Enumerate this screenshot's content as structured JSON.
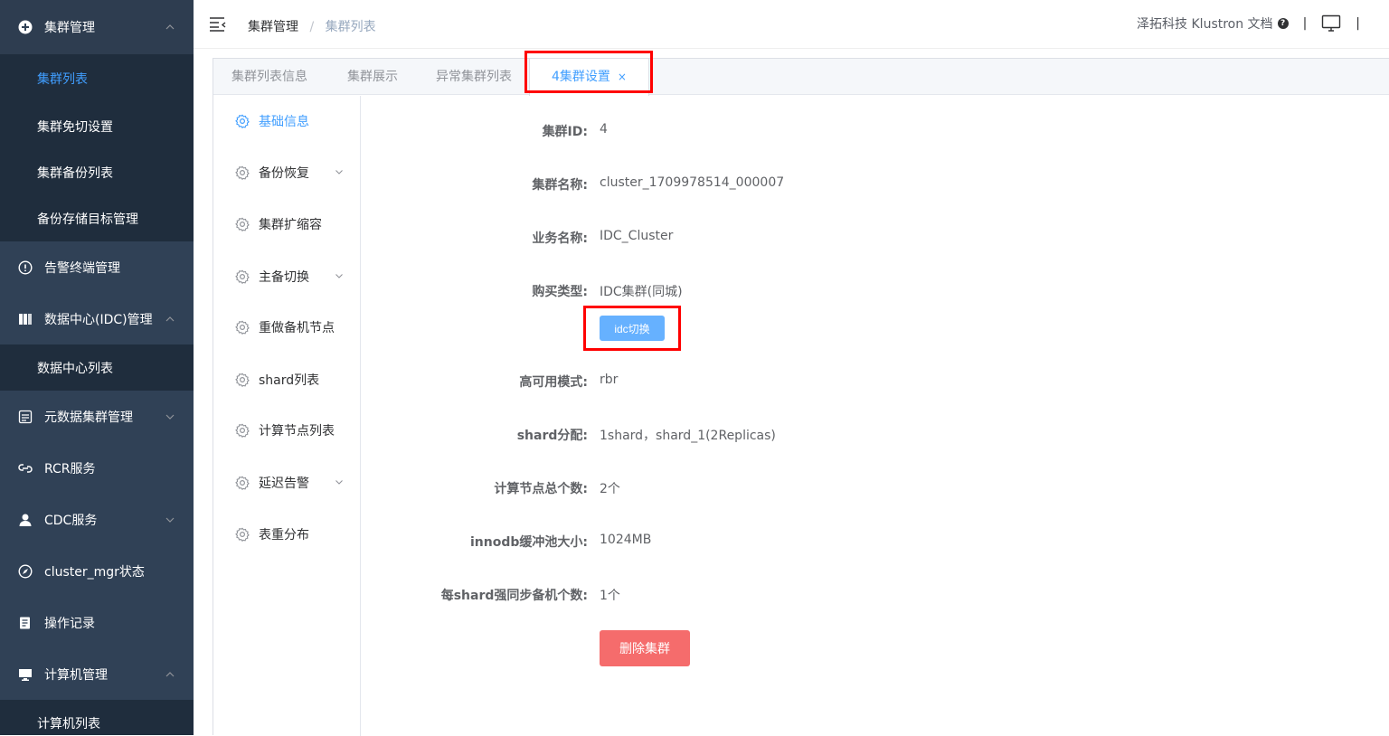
{
  "sidebar": {
    "groups": [
      {
        "label": "集群管理",
        "icon": "plus-circle-icon",
        "expanded": true,
        "items": [
          "集群列表",
          "集群免切设置",
          "集群备份列表",
          "备份存储目标管理"
        ],
        "active_item": "集群列表"
      },
      {
        "label": "告警终端管理",
        "icon": "info-circle-icon"
      },
      {
        "label": "数据中心(IDC)管理",
        "icon": "chart-bar-icon",
        "expanded": true,
        "items": [
          "数据中心列表"
        ]
      },
      {
        "label": "元数据集群管理",
        "icon": "database-icon"
      },
      {
        "label": "RCR服务",
        "icon": "link-icon"
      },
      {
        "label": "CDC服务",
        "icon": "user-icon"
      },
      {
        "label": "cluster_mgr状态",
        "icon": "compass-icon"
      },
      {
        "label": "操作记录",
        "icon": "log-icon"
      },
      {
        "label": "计算机管理",
        "icon": "computer-icon",
        "expanded": true,
        "items": [
          "计算机列表"
        ]
      }
    ]
  },
  "header": {
    "breadcrumb": [
      "集群管理",
      "集群列表"
    ],
    "separator": "/",
    "right_link": "泽拓科技 Klustron 文档",
    "help_icon": "?",
    "pipe": "|"
  },
  "tabs": [
    {
      "label": "集群列表信息"
    },
    {
      "label": "集群展示"
    },
    {
      "label": "异常集群列表"
    },
    {
      "label": "4集群设置",
      "active": true,
      "close": "×"
    }
  ],
  "side_menu": [
    {
      "label": "基础信息",
      "active": true
    },
    {
      "label": "备份恢复",
      "has_children": true
    },
    {
      "label": "集群扩缩容"
    },
    {
      "label": "主备切换",
      "has_children": true
    },
    {
      "label": "重做备机节点"
    },
    {
      "label": "shard列表"
    },
    {
      "label": "计算节点列表"
    },
    {
      "label": "延迟告警",
      "has_children": true
    },
    {
      "label": "表重分布"
    }
  ],
  "detail": [
    {
      "label": "集群ID:",
      "value": "4"
    },
    {
      "label": "集群名称:",
      "value": "cluster_1709978514_000007"
    },
    {
      "label": "业务名称:",
      "value": "IDC_Cluster"
    },
    {
      "label": "购买类型:",
      "value": "IDC集群(同城)"
    },
    {
      "label": "高可用模式:",
      "value": "rbr"
    },
    {
      "label": "shard分配:",
      "value": "1shard，shard_1(2Replicas)"
    },
    {
      "label": "计算节点总个数:",
      "value": "2个"
    },
    {
      "label": "innodb缓冲池大小:",
      "value": "1024MB"
    },
    {
      "label": "每shard强同步备机个数:",
      "value": "1个"
    }
  ],
  "buttons": {
    "idc_switch": "idc切换",
    "delete_cluster": "删除集群"
  },
  "colors": {
    "sidebar_bg": "#304156",
    "submenu_bg": "#1f2d3d",
    "accent": "#409eff",
    "danger": "#f56c6c",
    "highlight": "#ff0000"
  }
}
